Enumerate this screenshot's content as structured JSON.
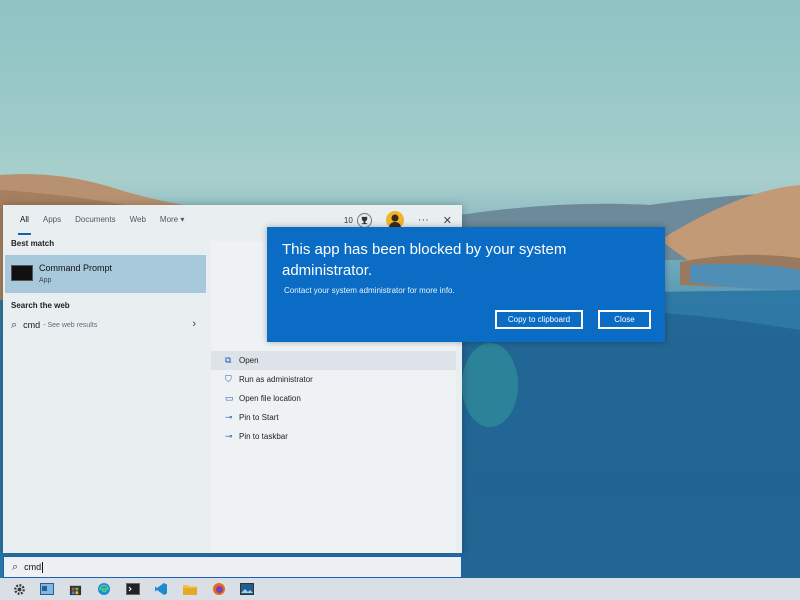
{
  "start_menu": {
    "tabs": [
      {
        "label": "All",
        "active": true
      },
      {
        "label": "Apps",
        "active": false
      },
      {
        "label": "Documents",
        "active": false
      },
      {
        "label": "Web",
        "active": false
      },
      {
        "label": "More ▾",
        "active": false
      }
    ],
    "points": "10",
    "more_glyph": "···",
    "close_glyph": "✕",
    "best_match_label": "Best match",
    "best_match": {
      "title": "Command Prompt",
      "subtitle": "App"
    },
    "search_web_label": "Search the web",
    "web_result": {
      "query": "cmd",
      "suffix": "- See web results"
    },
    "actions": [
      {
        "label": "Open",
        "icon": "open-icon",
        "glyph": "⧉"
      },
      {
        "label": "Run as administrator",
        "icon": "shield-icon",
        "glyph": "⛉"
      },
      {
        "label": "Open file location",
        "icon": "folder-icon",
        "glyph": "▭"
      },
      {
        "label": "Pin to Start",
        "icon": "pin-icon",
        "glyph": "⊸"
      },
      {
        "label": "Pin to taskbar",
        "icon": "pin-icon",
        "glyph": "⊸"
      }
    ]
  },
  "search_bar": {
    "value": "cmd"
  },
  "dialog": {
    "title": "This app has been blocked by your system administrator.",
    "message": "Contact your system administrator for more info.",
    "copy_button": "Copy to clipboard",
    "close_button": "Close"
  },
  "taskbar": {
    "icons": [
      "settings-icon",
      "task-view-icon",
      "store-icon",
      "edge-icon",
      "terminal-icon",
      "vscode-icon",
      "file-explorer-icon",
      "firefox-icon",
      "photos-icon"
    ]
  },
  "colors": {
    "accent": "#0a6cc4",
    "selection": "#a8c8db",
    "menu_bg": "#e9eef1"
  }
}
